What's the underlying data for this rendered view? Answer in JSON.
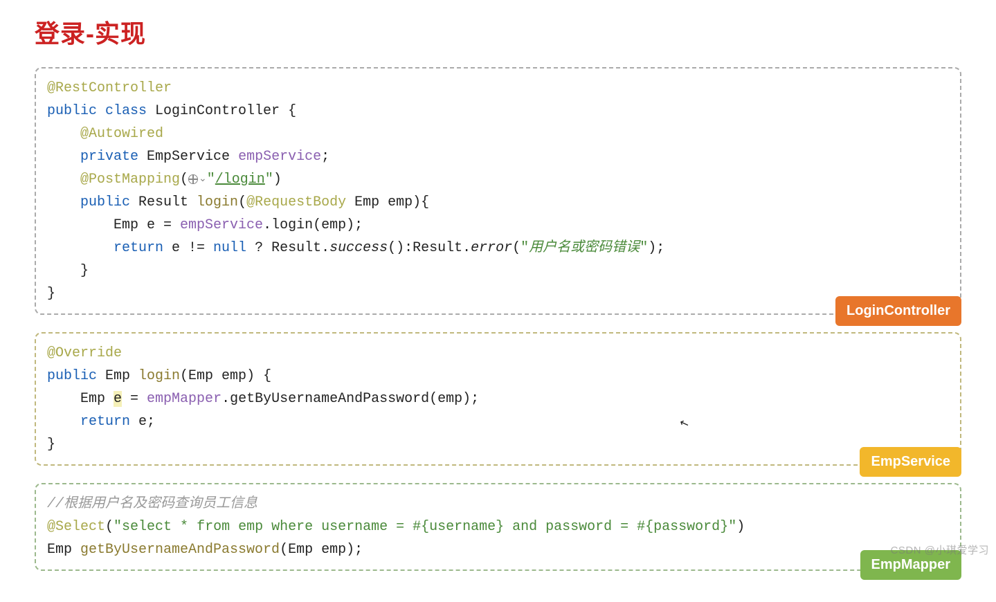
{
  "title": "登录-实现",
  "block1": {
    "badge": "LoginController",
    "l1_anno": "@RestController",
    "l2_kw": "public class ",
    "l2_cls": "LoginController",
    "l2_end": " {",
    "l3_anno": "    @Autowired",
    "l4_kw": "    private ",
    "l4_type": "EmpService ",
    "l4_field": "empService",
    "l4_end": ";",
    "l5_anno": "    @PostMapping",
    "l5_p1": "(",
    "l5_str": "\"",
    "l5_url": "/login",
    "l5_str2": "\"",
    "l5_p2": ")",
    "l6_kw": "    public ",
    "l6_type": "Result ",
    "l6_m": "login",
    "l6_p": "(",
    "l6_anno": "@RequestBody",
    "l6_rest": " Emp emp){",
    "l7_pre": "        Emp e = ",
    "l7_field": "empService",
    "l7_rest": ".login(emp);",
    "l8_kw": "        return ",
    "l8_mid": "e != ",
    "l8_null": "null",
    "l8_mid2": " ? Result.",
    "l8_m1": "success",
    "l8_mid3": "():Result.",
    "l8_m2": "error",
    "l8_p1": "(",
    "l8_q1": "\"",
    "l8_cn": "用户名或密码错误",
    "l8_q2": "\"",
    "l8_end": ");",
    "l9": "    }",
    "l10": "}"
  },
  "block2": {
    "badge": "EmpService",
    "l1_anno": "@Override",
    "l2_kw": "public ",
    "l2_type": "Emp ",
    "l2_m": "login",
    "l2_rest": "(Emp emp) {",
    "l3_pre": "    Emp ",
    "l3_e": "e",
    "l3_eq": " = ",
    "l3_field": "empMapper",
    "l3_rest": ".getByUsernameAndPassword(emp);",
    "l4_kw": "    return ",
    "l4_rest": "e;",
    "l5": "}"
  },
  "block3": {
    "badge": "EmpMapper",
    "l1_comment": "//根据用户名及密码查询员工信息",
    "l2_anno": "@Select",
    "l2_p1": "(",
    "l2_q1": "\"",
    "l2_s1": "select * from emp where username = #{username} and password = #{password}",
    "l2_q2": "\"",
    "l2_p2": ")",
    "l3_type": "Emp ",
    "l3_m": "getByUsernameAndPassword",
    "l3_rest": "(Emp emp);"
  },
  "watermark": "CSDN @小琪爱学习"
}
